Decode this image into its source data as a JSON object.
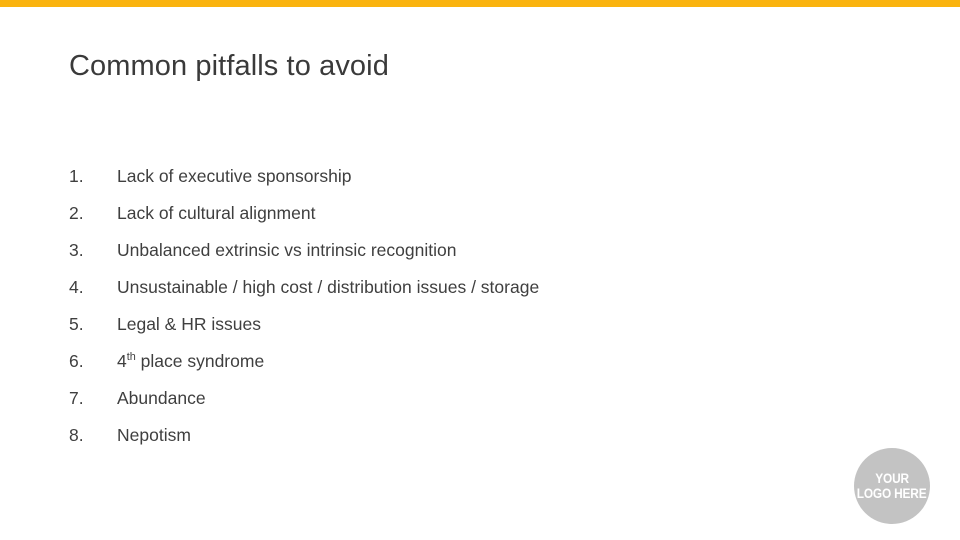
{
  "slide": {
    "title": "Common pitfalls to avoid",
    "accent_color": "#fab30e",
    "background_color": "#ffffff",
    "text_color": "#3f3f3f"
  },
  "pitfalls": [
    {
      "number": "1.",
      "text": "Lack of executive sponsorship"
    },
    {
      "number": "2.",
      "text": "Lack of cultural alignment"
    },
    {
      "number": "3.",
      "text": "Unbalanced extrinsic vs intrinsic recognition"
    },
    {
      "number": "4.",
      "text": "Unsustainable / high cost / distribution issues / storage"
    },
    {
      "number": "5.",
      "text": "Legal & HR issues"
    },
    {
      "number": "6.",
      "text": "4th place syndrome",
      "base": "4",
      "superscript": "th",
      "rest": " place syndrome"
    },
    {
      "number": "7.",
      "text": "Abundance"
    },
    {
      "number": "8.",
      "text": "Nepotism"
    }
  ],
  "logo": {
    "line1": "YOUR",
    "line2": "LOGO HERE",
    "shape_color": "#c3c3c3",
    "text_color": "#ffffff"
  }
}
